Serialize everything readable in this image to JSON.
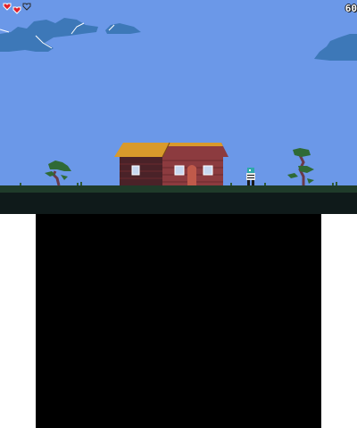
{
  "hud": {
    "hearts_full": 2,
    "hearts_total": 3,
    "fps": "60"
  },
  "colors": {
    "sky": "#6b98e8",
    "cloud": "#3d78b8",
    "ground_grass": "#1f3b2a",
    "ground_dark": "#0f1a1a",
    "roof": "#d99a2b",
    "wall": "#8c3b3f",
    "heart": "#e0202a"
  },
  "scene": {
    "objects": [
      "cloud-icon",
      "house",
      "bonsai-tree-icon",
      "player-icon",
      "heart-icon"
    ]
  }
}
